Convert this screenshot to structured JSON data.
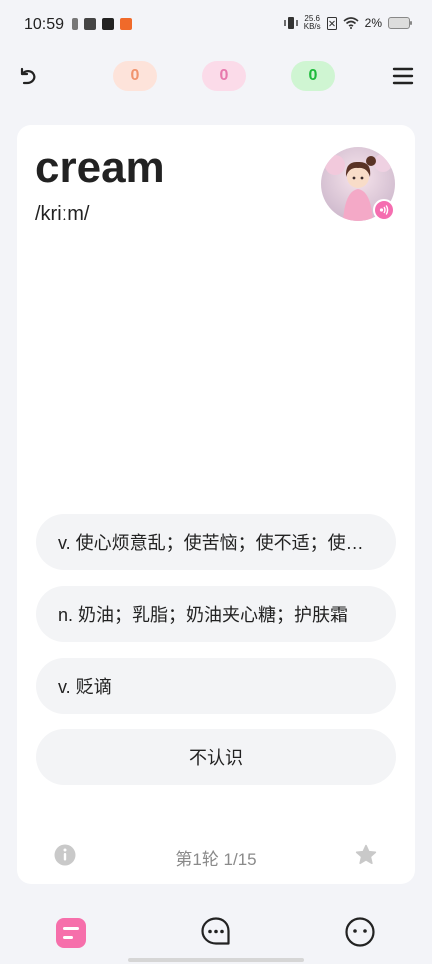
{
  "status_bar": {
    "time": "10:59",
    "speed_value": "25.6",
    "speed_unit": "KB/s",
    "battery": "2%"
  },
  "top_bar": {
    "counts": [
      "0",
      "0",
      "0"
    ],
    "count_colors": [
      "#f0936d",
      "#e779ad",
      "#1dba3a"
    ],
    "icons": [
      "back-icon",
      "menu-icon"
    ]
  },
  "card": {
    "word": "cream",
    "phonetic": "/kriːm/",
    "options": [
      "v. 使心烦意乱；使苦恼；使不适；使紧张",
      "n. 奶油；乳脂；奶油夹心糖；护肤霜",
      "v. 贬谪"
    ],
    "unknown_label": "不认识",
    "round_label": "第1轮 1/15",
    "icons": [
      "info-icon",
      "star-icon",
      "speaker-icon"
    ]
  },
  "bottom_nav": {
    "icons": [
      "flashcard-icon",
      "chat-icon",
      "face-icon"
    ],
    "accent": "#f66fab"
  }
}
